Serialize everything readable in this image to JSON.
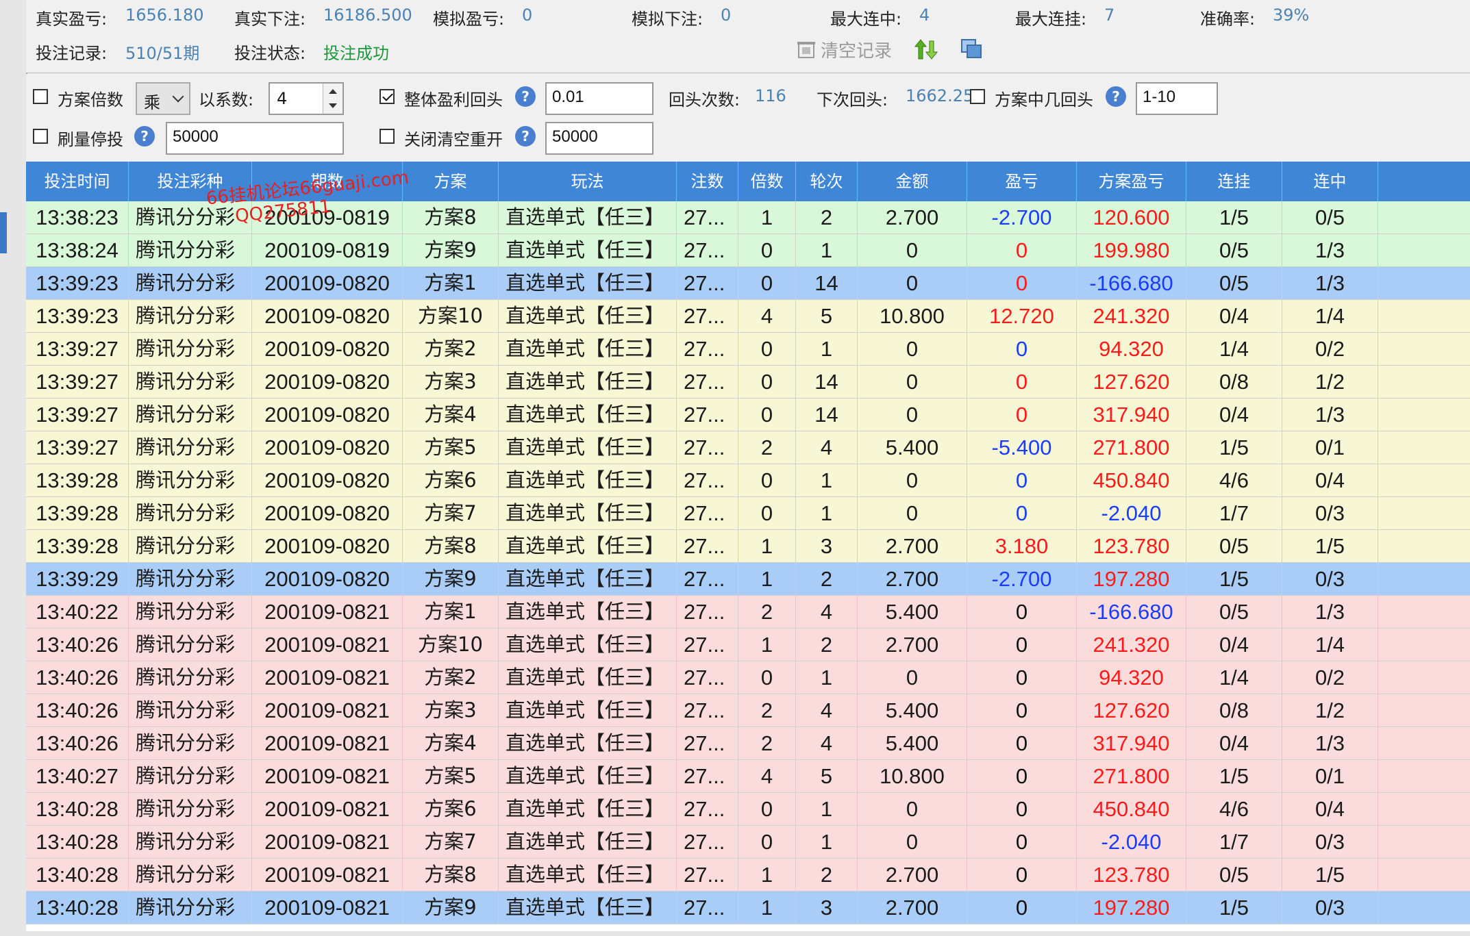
{
  "stats": {
    "real_profit_label": "真实盈亏:",
    "real_profit_value": "1656.180",
    "real_bet_label": "真实下注:",
    "real_bet_value": "16186.500",
    "sim_profit_label": "模拟盈亏:",
    "sim_profit_value": "0",
    "sim_bet_label": "模拟下注:",
    "sim_bet_value": "0",
    "max_win_streak_label": "最大连中:",
    "max_win_streak_value": "4",
    "max_loss_streak_label": "最大连挂:",
    "max_loss_streak_value": "7",
    "accuracy_label": "准确率:",
    "accuracy_value": "39%",
    "record_label": "投注记录:",
    "record_value": "510/51期",
    "status_label": "投注状态:",
    "status_value": "投注成功",
    "clear_label": "清空记录"
  },
  "options": {
    "plan_multiplier_label": "方案倍数",
    "multiplier_select": "乘",
    "coefficient_label": "以系数:",
    "coefficient_value": "4",
    "overall_profit_label": "整体盈利回头",
    "overall_profit_value": "0.01",
    "return_count_label": "回头次数:",
    "return_count_value": "116",
    "next_return_label": "下次回头:",
    "next_return_value": "1662.250",
    "plan_range_label": "方案中几回头",
    "plan_range_value": "1-10",
    "stop_amount_label": "刷量停投",
    "stop_amount_value": "50000",
    "close_clear_label": "关闭清空重开",
    "close_clear_value": "50000"
  },
  "watermark": {
    "line1": "66挂机论坛66guaji.com",
    "line2": "QQ275811"
  },
  "columns": [
    "投注时间",
    "投注彩种",
    "期数",
    "方案",
    "玩法",
    "注数",
    "倍数",
    "轮次",
    "金额",
    "盈亏",
    "方案盈亏",
    "连挂",
    "连中"
  ],
  "rows": [
    {
      "time": "13:38:23",
      "lottery": "腾讯分分彩",
      "period": "200109-0819",
      "plan": "方案8",
      "play": "直选单式【任三】",
      "count": "27...",
      "mult": "1",
      "round": "2",
      "amount": "2.700",
      "profit": "-2.700",
      "plan_profit": "120.600",
      "loss_streak": "1/5",
      "win_streak": "0/5",
      "bg": "#d9f8d9",
      "profit_color": "blue",
      "plan_color": "red"
    },
    {
      "time": "13:38:24",
      "lottery": "腾讯分分彩",
      "period": "200109-0819",
      "plan": "方案9",
      "play": "直选单式【任三】",
      "count": "27...",
      "mult": "0",
      "round": "1",
      "amount": "0",
      "profit": "0",
      "plan_profit": "199.980",
      "loss_streak": "0/5",
      "win_streak": "1/3",
      "bg": "#d9f8d9",
      "profit_color": "red",
      "plan_color": "red"
    },
    {
      "time": "13:39:23",
      "lottery": "腾讯分分彩",
      "period": "200109-0820",
      "plan": "方案1",
      "play": "直选单式【任三】",
      "count": "27...",
      "mult": "0",
      "round": "14",
      "amount": "0",
      "profit": "0",
      "plan_profit": "-166.680",
      "loss_streak": "0/5",
      "win_streak": "1/3",
      "bg": "#a9cdf6",
      "profit_color": "red",
      "plan_color": "blue"
    },
    {
      "time": "13:39:23",
      "lottery": "腾讯分分彩",
      "period": "200109-0820",
      "plan": "方案10",
      "play": "直选单式【任三】",
      "count": "27...",
      "mult": "4",
      "round": "5",
      "amount": "10.800",
      "profit": "12.720",
      "plan_profit": "241.320",
      "loss_streak": "0/4",
      "win_streak": "1/4",
      "bg": "#f7f7d6",
      "profit_color": "red",
      "plan_color": "red"
    },
    {
      "time": "13:39:27",
      "lottery": "腾讯分分彩",
      "period": "200109-0820",
      "plan": "方案2",
      "play": "直选单式【任三】",
      "count": "27...",
      "mult": "0",
      "round": "1",
      "amount": "0",
      "profit": "0",
      "plan_profit": "94.320",
      "loss_streak": "1/4",
      "win_streak": "0/2",
      "bg": "#f7f7d6",
      "profit_color": "blue",
      "plan_color": "red"
    },
    {
      "time": "13:39:27",
      "lottery": "腾讯分分彩",
      "period": "200109-0820",
      "plan": "方案3",
      "play": "直选单式【任三】",
      "count": "27...",
      "mult": "0",
      "round": "14",
      "amount": "0",
      "profit": "0",
      "plan_profit": "127.620",
      "loss_streak": "0/8",
      "win_streak": "1/2",
      "bg": "#f7f7d6",
      "profit_color": "red",
      "plan_color": "red"
    },
    {
      "time": "13:39:27",
      "lottery": "腾讯分分彩",
      "period": "200109-0820",
      "plan": "方案4",
      "play": "直选单式【任三】",
      "count": "27...",
      "mult": "0",
      "round": "14",
      "amount": "0",
      "profit": "0",
      "plan_profit": "317.940",
      "loss_streak": "0/4",
      "win_streak": "1/3",
      "bg": "#f7f7d6",
      "profit_color": "red",
      "plan_color": "red"
    },
    {
      "time": "13:39:27",
      "lottery": "腾讯分分彩",
      "period": "200109-0820",
      "plan": "方案5",
      "play": "直选单式【任三】",
      "count": "27...",
      "mult": "2",
      "round": "4",
      "amount": "5.400",
      "profit": "-5.400",
      "plan_profit": "271.800",
      "loss_streak": "1/5",
      "win_streak": "0/1",
      "bg": "#f7f7d6",
      "profit_color": "blue",
      "plan_color": "red"
    },
    {
      "time": "13:39:28",
      "lottery": "腾讯分分彩",
      "period": "200109-0820",
      "plan": "方案6",
      "play": "直选单式【任三】",
      "count": "27...",
      "mult": "0",
      "round": "1",
      "amount": "0",
      "profit": "0",
      "plan_profit": "450.840",
      "loss_streak": "4/6",
      "win_streak": "0/4",
      "bg": "#f7f7d6",
      "profit_color": "blue",
      "plan_color": "red"
    },
    {
      "time": "13:39:28",
      "lottery": "腾讯分分彩",
      "period": "200109-0820",
      "plan": "方案7",
      "play": "直选单式【任三】",
      "count": "27...",
      "mult": "0",
      "round": "1",
      "amount": "0",
      "profit": "0",
      "plan_profit": "-2.040",
      "loss_streak": "1/7",
      "win_streak": "0/3",
      "bg": "#f7f7d6",
      "profit_color": "blue",
      "plan_color": "blue"
    },
    {
      "time": "13:39:28",
      "lottery": "腾讯分分彩",
      "period": "200109-0820",
      "plan": "方案8",
      "play": "直选单式【任三】",
      "count": "27...",
      "mult": "1",
      "round": "3",
      "amount": "2.700",
      "profit": "3.180",
      "plan_profit": "123.780",
      "loss_streak": "0/5",
      "win_streak": "1/5",
      "bg": "#f7f7d6",
      "profit_color": "red",
      "plan_color": "red"
    },
    {
      "time": "13:39:29",
      "lottery": "腾讯分分彩",
      "period": "200109-0820",
      "plan": "方案9",
      "play": "直选单式【任三】",
      "count": "27...",
      "mult": "1",
      "round": "2",
      "amount": "2.700",
      "profit": "-2.700",
      "plan_profit": "197.280",
      "loss_streak": "1/5",
      "win_streak": "0/3",
      "bg": "#a9cdf6",
      "profit_color": "blue",
      "plan_color": "red"
    },
    {
      "time": "13:40:22",
      "lottery": "腾讯分分彩",
      "period": "200109-0821",
      "plan": "方案1",
      "play": "直选单式【任三】",
      "count": "27...",
      "mult": "2",
      "round": "4",
      "amount": "5.400",
      "profit": "0",
      "plan_profit": "-166.680",
      "loss_streak": "0/5",
      "win_streak": "1/3",
      "bg": "#fbdcdc",
      "profit_color": "dark",
      "plan_color": "blue"
    },
    {
      "time": "13:40:26",
      "lottery": "腾讯分分彩",
      "period": "200109-0821",
      "plan": "方案10",
      "play": "直选单式【任三】",
      "count": "27...",
      "mult": "1",
      "round": "2",
      "amount": "2.700",
      "profit": "0",
      "plan_profit": "241.320",
      "loss_streak": "0/4",
      "win_streak": "1/4",
      "bg": "#fbdcdc",
      "profit_color": "dark",
      "plan_color": "red"
    },
    {
      "time": "13:40:26",
      "lottery": "腾讯分分彩",
      "period": "200109-0821",
      "plan": "方案2",
      "play": "直选单式【任三】",
      "count": "27...",
      "mult": "0",
      "round": "1",
      "amount": "0",
      "profit": "0",
      "plan_profit": "94.320",
      "loss_streak": "1/4",
      "win_streak": "0/2",
      "bg": "#fbdcdc",
      "profit_color": "dark",
      "plan_color": "red"
    },
    {
      "time": "13:40:26",
      "lottery": "腾讯分分彩",
      "period": "200109-0821",
      "plan": "方案3",
      "play": "直选单式【任三】",
      "count": "27...",
      "mult": "2",
      "round": "4",
      "amount": "5.400",
      "profit": "0",
      "plan_profit": "127.620",
      "loss_streak": "0/8",
      "win_streak": "1/2",
      "bg": "#fbdcdc",
      "profit_color": "dark",
      "plan_color": "red"
    },
    {
      "time": "13:40:26",
      "lottery": "腾讯分分彩",
      "period": "200109-0821",
      "plan": "方案4",
      "play": "直选单式【任三】",
      "count": "27...",
      "mult": "2",
      "round": "4",
      "amount": "5.400",
      "profit": "0",
      "plan_profit": "317.940",
      "loss_streak": "0/4",
      "win_streak": "1/3",
      "bg": "#fbdcdc",
      "profit_color": "dark",
      "plan_color": "red"
    },
    {
      "time": "13:40:27",
      "lottery": "腾讯分分彩",
      "period": "200109-0821",
      "plan": "方案5",
      "play": "直选单式【任三】",
      "count": "27...",
      "mult": "4",
      "round": "5",
      "amount": "10.800",
      "profit": "0",
      "plan_profit": "271.800",
      "loss_streak": "1/5",
      "win_streak": "0/1",
      "bg": "#fbdcdc",
      "profit_color": "dark",
      "plan_color": "red"
    },
    {
      "time": "13:40:28",
      "lottery": "腾讯分分彩",
      "period": "200109-0821",
      "plan": "方案6",
      "play": "直选单式【任三】",
      "count": "27...",
      "mult": "0",
      "round": "1",
      "amount": "0",
      "profit": "0",
      "plan_profit": "450.840",
      "loss_streak": "4/6",
      "win_streak": "0/4",
      "bg": "#fbdcdc",
      "profit_color": "dark",
      "plan_color": "red"
    },
    {
      "time": "13:40:28",
      "lottery": "腾讯分分彩",
      "period": "200109-0821",
      "plan": "方案7",
      "play": "直选单式【任三】",
      "count": "27...",
      "mult": "0",
      "round": "1",
      "amount": "0",
      "profit": "0",
      "plan_profit": "-2.040",
      "loss_streak": "1/7",
      "win_streak": "0/3",
      "bg": "#fbdcdc",
      "profit_color": "dark",
      "plan_color": "blue"
    },
    {
      "time": "13:40:28",
      "lottery": "腾讯分分彩",
      "period": "200109-0821",
      "plan": "方案8",
      "play": "直选单式【任三】",
      "count": "27...",
      "mult": "1",
      "round": "2",
      "amount": "2.700",
      "profit": "0",
      "plan_profit": "123.780",
      "loss_streak": "0/5",
      "win_streak": "1/5",
      "bg": "#fbdcdc",
      "profit_color": "dark",
      "plan_color": "red"
    },
    {
      "time": "13:40:28",
      "lottery": "腾讯分分彩",
      "period": "200109-0821",
      "plan": "方案9",
      "play": "直选单式【任三】",
      "count": "27...",
      "mult": "1",
      "round": "3",
      "amount": "2.700",
      "profit": "0",
      "plan_profit": "197.280",
      "loss_streak": "1/5",
      "win_streak": "0/3",
      "bg": "#a9cdf6",
      "profit_color": "dark",
      "plan_color": "red"
    }
  ]
}
